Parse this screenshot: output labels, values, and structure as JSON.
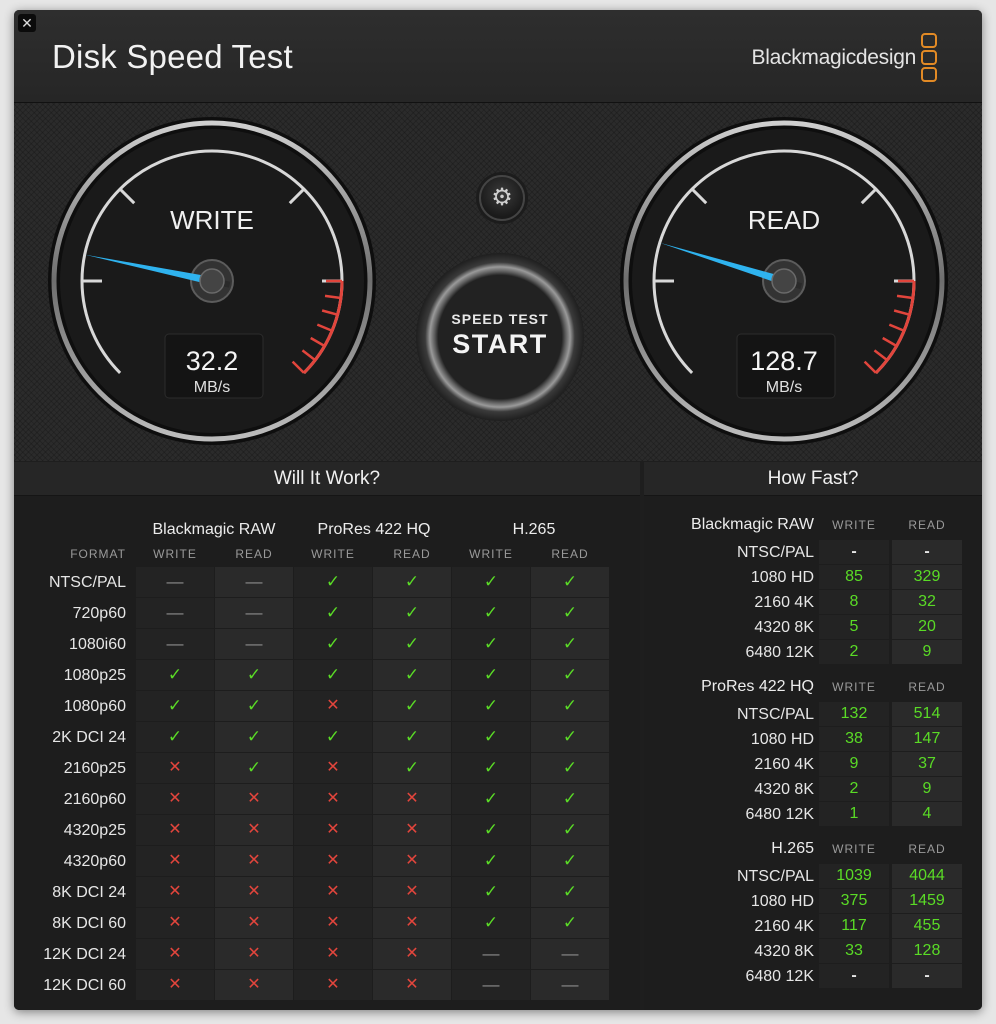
{
  "window": {
    "title": "Disk Speed Test",
    "brand": "Blackmagicdesign",
    "close_icon": "close-icon",
    "accent_color": "#e28a25"
  },
  "gauges": {
    "write": {
      "label": "WRITE",
      "value": "32.2",
      "unit": "MB/s"
    },
    "read": {
      "label": "READ",
      "value": "128.7",
      "unit": "MB/s"
    },
    "needle_color": "#2fb3ef",
    "redline_color": "#e2453c"
  },
  "controls": {
    "settings_icon": "gear-icon",
    "start_small": "SPEED TEST",
    "start_big": "START"
  },
  "will_it_work": {
    "title": "Will It Work?",
    "format_header": "FORMAT",
    "codecs": [
      "Blackmagic RAW",
      "ProRes 422 HQ",
      "H.265"
    ],
    "subheaders": [
      "WRITE",
      "READ",
      "WRITE",
      "READ",
      "WRITE",
      "READ"
    ],
    "rows": [
      {
        "format": "NTSC/PAL",
        "status": [
          "na",
          "na",
          "ok",
          "ok",
          "ok",
          "ok"
        ]
      },
      {
        "format": "720p60",
        "status": [
          "na",
          "na",
          "ok",
          "ok",
          "ok",
          "ok"
        ]
      },
      {
        "format": "1080i60",
        "status": [
          "na",
          "na",
          "ok",
          "ok",
          "ok",
          "ok"
        ]
      },
      {
        "format": "1080p25",
        "status": [
          "ok",
          "ok",
          "ok",
          "ok",
          "ok",
          "ok"
        ]
      },
      {
        "format": "1080p60",
        "status": [
          "ok",
          "ok",
          "bad",
          "ok",
          "ok",
          "ok"
        ]
      },
      {
        "format": "2K DCI 24",
        "status": [
          "ok",
          "ok",
          "ok",
          "ok",
          "ok",
          "ok"
        ]
      },
      {
        "format": "2160p25",
        "status": [
          "bad",
          "ok",
          "bad",
          "ok",
          "ok",
          "ok"
        ]
      },
      {
        "format": "2160p60",
        "status": [
          "bad",
          "bad",
          "bad",
          "bad",
          "ok",
          "ok"
        ]
      },
      {
        "format": "4320p25",
        "status": [
          "bad",
          "bad",
          "bad",
          "bad",
          "ok",
          "ok"
        ]
      },
      {
        "format": "4320p60",
        "status": [
          "bad",
          "bad",
          "bad",
          "bad",
          "ok",
          "ok"
        ]
      },
      {
        "format": "8K DCI 24",
        "status": [
          "bad",
          "bad",
          "bad",
          "bad",
          "ok",
          "ok"
        ]
      },
      {
        "format": "8K DCI 60",
        "status": [
          "bad",
          "bad",
          "bad",
          "bad",
          "ok",
          "ok"
        ]
      },
      {
        "format": "12K DCI 24",
        "status": [
          "bad",
          "bad",
          "bad",
          "bad",
          "na",
          "na"
        ]
      },
      {
        "format": "12K DCI 60",
        "status": [
          "bad",
          "bad",
          "bad",
          "bad",
          "na",
          "na"
        ]
      }
    ],
    "glyphs": {
      "ok": "✓",
      "bad": "✕",
      "na": "—"
    }
  },
  "how_fast": {
    "title": "How Fast?",
    "col_write": "WRITE",
    "col_read": "READ",
    "sections": [
      {
        "name": "Blackmagic RAW",
        "rows": [
          {
            "format": "NTSC/PAL",
            "write": "-",
            "read": "-"
          },
          {
            "format": "1080 HD",
            "write": "85",
            "read": "329"
          },
          {
            "format": "2160 4K",
            "write": "8",
            "read": "32"
          },
          {
            "format": "4320 8K",
            "write": "5",
            "read": "20"
          },
          {
            "format": "6480 12K",
            "write": "2",
            "read": "9"
          }
        ]
      },
      {
        "name": "ProRes 422 HQ",
        "rows": [
          {
            "format": "NTSC/PAL",
            "write": "132",
            "read": "514"
          },
          {
            "format": "1080 HD",
            "write": "38",
            "read": "147"
          },
          {
            "format": "2160 4K",
            "write": "9",
            "read": "37"
          },
          {
            "format": "4320 8K",
            "write": "2",
            "read": "9"
          },
          {
            "format": "6480 12K",
            "write": "1",
            "read": "4"
          }
        ]
      },
      {
        "name": "H.265",
        "rows": [
          {
            "format": "NTSC/PAL",
            "write": "1039",
            "read": "4044"
          },
          {
            "format": "1080 HD",
            "write": "375",
            "read": "1459"
          },
          {
            "format": "2160 4K",
            "write": "117",
            "read": "455"
          },
          {
            "format": "4320 8K",
            "write": "33",
            "read": "128"
          },
          {
            "format": "6480 12K",
            "write": "-",
            "read": "-"
          }
        ]
      }
    ]
  }
}
